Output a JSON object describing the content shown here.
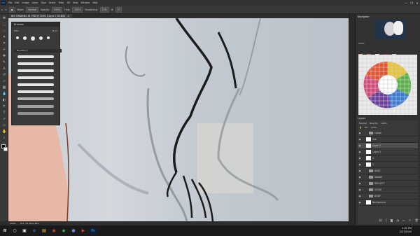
{
  "app": {
    "logo_text": "Ps"
  },
  "menubar": {
    "items": [
      "File",
      "Edit",
      "Image",
      "Layer",
      "Type",
      "Select",
      "Filter",
      "3D",
      "View",
      "Window",
      "Help"
    ]
  },
  "window_controls": [
    "—",
    "❐",
    "✕"
  ],
  "options_bar": {
    "mode_label": "Mode:",
    "mode_value": "Normal",
    "opacity_label": "Opacity:",
    "opacity_value": "100%",
    "flow_label": "Flow:",
    "flow_value": "100%",
    "smoothing_label": "Smoothing:",
    "smoothing_value": "10%",
    "angle_value": "0°"
  },
  "document_tab": {
    "title": "BEE DRAWING IN .PSD @ 200% (Layer 2, RGB/8)",
    "close": "×"
  },
  "brushes_panel": {
    "title": "Brushes",
    "size_label": "Size:",
    "size_value": "11 px",
    "folder": "Brushes_2"
  },
  "status_bar": {
    "zoom": "200%",
    "doc_info": "Doc: 34.3M/1.42G"
  },
  "navigator": {
    "title": "Navigator",
    "zoom": "200%"
  },
  "layers_panel": {
    "title": "Layers",
    "mode": "Normal",
    "opacity_label": "Opacity:",
    "opacity_value": "100%",
    "fill_label": "Fill:",
    "fill_value": "100%",
    "layers": [
      {
        "name": "Folder",
        "kind": "folder"
      },
      {
        "name": "line",
        "kind": "layer"
      },
      {
        "name": "Layer 2",
        "kind": "layer",
        "selected": true
      },
      {
        "name": "Layer 3",
        "kind": "layer"
      },
      {
        "name": "2",
        "kind": "layer"
      },
      {
        "name": "1",
        "kind": "layer"
      },
      {
        "name": "BASE",
        "kind": "folder"
      },
      {
        "name": "SHADE",
        "kind": "folder"
      },
      {
        "name": "REFLECT",
        "kind": "folder"
      },
      {
        "name": "GLOW",
        "kind": "folder"
      },
      {
        "name": "BODY",
        "kind": "folder"
      },
      {
        "name": "Background",
        "kind": "layer"
      }
    ]
  },
  "taskbar": {
    "time": "4:01 PM",
    "date": "2/27/2020"
  },
  "colors": {
    "accent": "#31a8ff",
    "panel": "#323232",
    "canvas": "#c6cdd3"
  }
}
